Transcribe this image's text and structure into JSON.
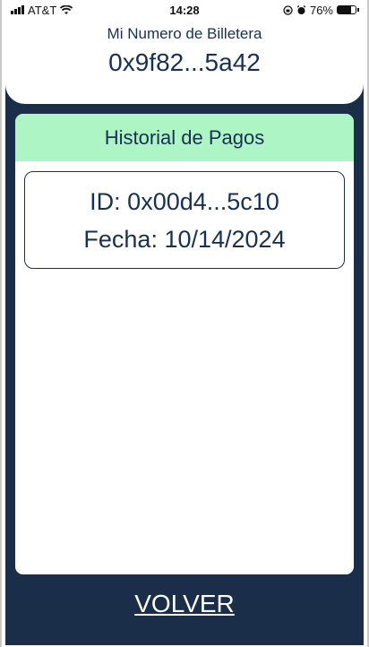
{
  "status_bar": {
    "carrier": "AT&T",
    "time": "14:28",
    "battery_percent": "76%",
    "battery_level": 0.76
  },
  "header": {
    "label": "Mi Numero de Billetera",
    "wallet_number": "0x9f82...5a42"
  },
  "history": {
    "title": "Historial de Pagos",
    "items": [
      {
        "id": "ID: 0x00d4...5c10",
        "date": "Fecha: 10/14/2024"
      }
    ]
  },
  "footer": {
    "back_label": "VOLVER"
  },
  "colors": {
    "navy": "#1a2e4a",
    "mint": "#aef5c6",
    "text_dark": "#173152"
  }
}
